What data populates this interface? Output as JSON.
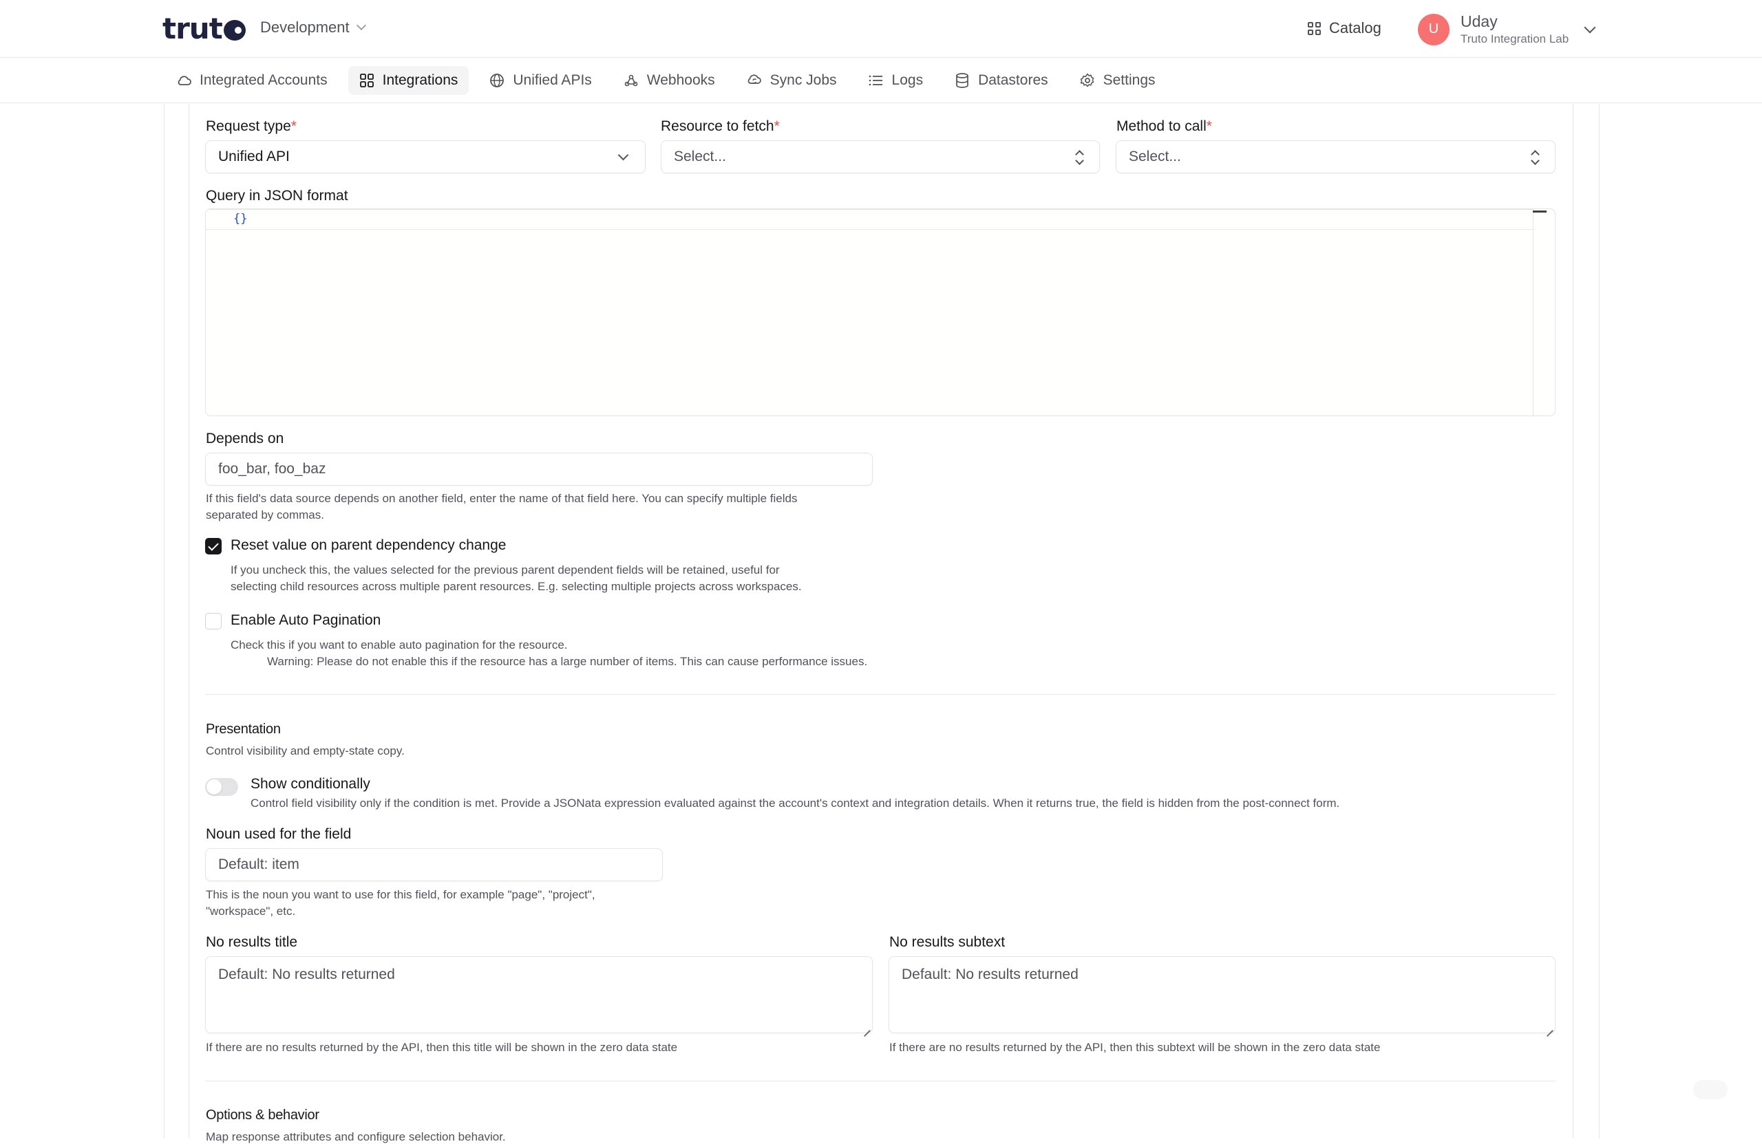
{
  "header": {
    "logo": "truto",
    "environment": "Development",
    "catalog_label": "Catalog",
    "user_initial": "U",
    "user_name": "Uday",
    "user_org": "Truto Integration Lab"
  },
  "nav": {
    "items": [
      {
        "label": "Integrated Accounts",
        "icon": "cloud-icon"
      },
      {
        "label": "Integrations",
        "icon": "grid-icon",
        "active": true
      },
      {
        "label": "Unified APIs",
        "icon": "globe-icon"
      },
      {
        "label": "Webhooks",
        "icon": "webhook-icon"
      },
      {
        "label": "Sync Jobs",
        "icon": "sync-icon"
      },
      {
        "label": "Logs",
        "icon": "list-icon"
      },
      {
        "label": "Datastores",
        "icon": "database-icon"
      },
      {
        "label": "Settings",
        "icon": "gear-icon"
      }
    ]
  },
  "form": {
    "request_type": {
      "label": "Request type",
      "required_mark": "*",
      "value": "Unified API"
    },
    "resource": {
      "label": "Resource to fetch",
      "required_mark": "*",
      "value": "Select..."
    },
    "method": {
      "label": "Method to call",
      "required_mark": "*",
      "value": "Select..."
    },
    "query": {
      "label": "Query in JSON format",
      "value": "{}"
    },
    "depends_on": {
      "label": "Depends on",
      "placeholder": "foo_bar, foo_baz",
      "help_line1": "If this field's data source depends on another field, enter the name of that field here. You can specify multiple fields",
      "help_line2": "separated by commas."
    },
    "reset_value": {
      "label": "Reset value on parent dependency change",
      "checked": true,
      "help_line1": "If you uncheck this, the values selected for the previous parent dependent fields will be retained, useful for",
      "help_line2": "selecting child resources across multiple parent resources. E.g. selecting multiple projects across workspaces."
    },
    "auto_pagination": {
      "label": "Enable Auto Pagination",
      "checked": false,
      "help_line1": "Check this if you want to enable auto pagination for the resource.",
      "help_line2": "Warning: Please do not enable this if the resource has a large number of items. This can cause performance issues."
    }
  },
  "presentation": {
    "title": "Presentation",
    "subtitle": "Control visibility and empty-state copy.",
    "show_conditionally": {
      "label": "Show conditionally",
      "enabled": false,
      "help": "Control field visibility only if the condition is met. Provide a JSONata expression evaluated against the account's context and integration details. When it returns true, the field is hidden from the post-connect form."
    },
    "noun": {
      "label": "Noun used for the field",
      "placeholder": "Default: item",
      "help_line1": "This is the noun you want to use for this field, for example \"page\", \"project\",",
      "help_line2": "\"workspace\", etc."
    },
    "no_results_title": {
      "label": "No results title",
      "placeholder": "Default: No results returned",
      "help": "If there are no results returned by the API, then this title will be shown in the zero data state"
    },
    "no_results_subtext": {
      "label": "No results subtext",
      "placeholder": "Default: No results returned",
      "help": "If there are no results returned by the API, then this subtext will be shown in the zero data state"
    }
  },
  "options": {
    "title": "Options & behavior",
    "subtitle": "Map response attributes and configure selection behavior."
  }
}
